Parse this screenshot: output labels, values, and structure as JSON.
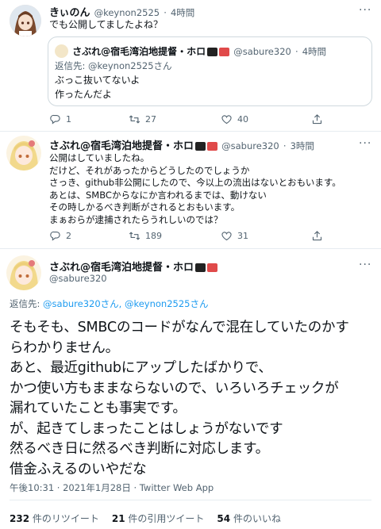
{
  "tweet1": {
    "display_name": "きぃのん",
    "handle": "@keynon2525",
    "sep": "·",
    "time": "4時間",
    "text": "でも公開してましたよね？"
  },
  "quote": {
    "display_name": "さぶれ@宿毛湾泊地提督・ホロ",
    "handle": "@sabure320",
    "sep": "·",
    "time": "4時間",
    "reply_prefix": "返信先: ",
    "reply_to": "@keynon2525さん",
    "lines": [
      "ぶっこ抜いてないよ",
      "作ったんだよ"
    ]
  },
  "tweet1_actions": {
    "reply": "1",
    "retweet": "27",
    "like": "40"
  },
  "tweet2": {
    "display_name": "さぶれ@宿毛湾泊地提督・ホロ",
    "handle": "@sabure320",
    "sep": "·",
    "time": "3時間",
    "lines": [
      "公開はしていましたね。",
      "だけど、それがあったからどうしたのでしょうか",
      "さっき、github非公開にしたので、今以上の流出はないとおもいます。",
      "あとは、SMBCからなにか言われるまでは、動けない",
      "その時しかるべき判断がされるとおもいます。",
      "まぁおらが逮捕されたらうれしいのでは？"
    ]
  },
  "tweet2_actions": {
    "reply": "2",
    "retweet": "189",
    "like": "31"
  },
  "main": {
    "display_name": "さぶれ@宿毛湾泊地提督・ホロ",
    "handle": "@sabure320",
    "reply_prefix": "返信先: ",
    "reply_to": "@sabure320さん, @keynon2525さん",
    "lines": [
      "そもそも、SMBCのコードがなんで混在していたのかす",
      "らわかりません。",
      "あと、最近githubにアップしたばかりで、",
      "かつ使い方もままならないので、いろいろチェックが",
      "漏れていたことも事実です。",
      "が、起きてしまったことはしょうがないです",
      "然るべき日に然るべき判断に対応します。",
      "借金ふえるのいやだな"
    ],
    "timestamp": "午後10:31 · 2021年1月28日 · Twitter Web App",
    "stats": {
      "retweets": "232",
      "retweets_label": " 件のリツイート",
      "quotes": "21",
      "quotes_label": " 件の引用ツイート",
      "likes": "54",
      "likes_label": " 件のいいね"
    }
  },
  "icons": {
    "reply": "reply-icon",
    "retweet": "retweet-icon",
    "like": "heart-icon",
    "share": "share-icon",
    "more": "more-icon"
  },
  "colors": {
    "text": "#0f1419",
    "secondary": "#536471",
    "link": "#1d9bf0",
    "divider": "#e6ecf0"
  }
}
